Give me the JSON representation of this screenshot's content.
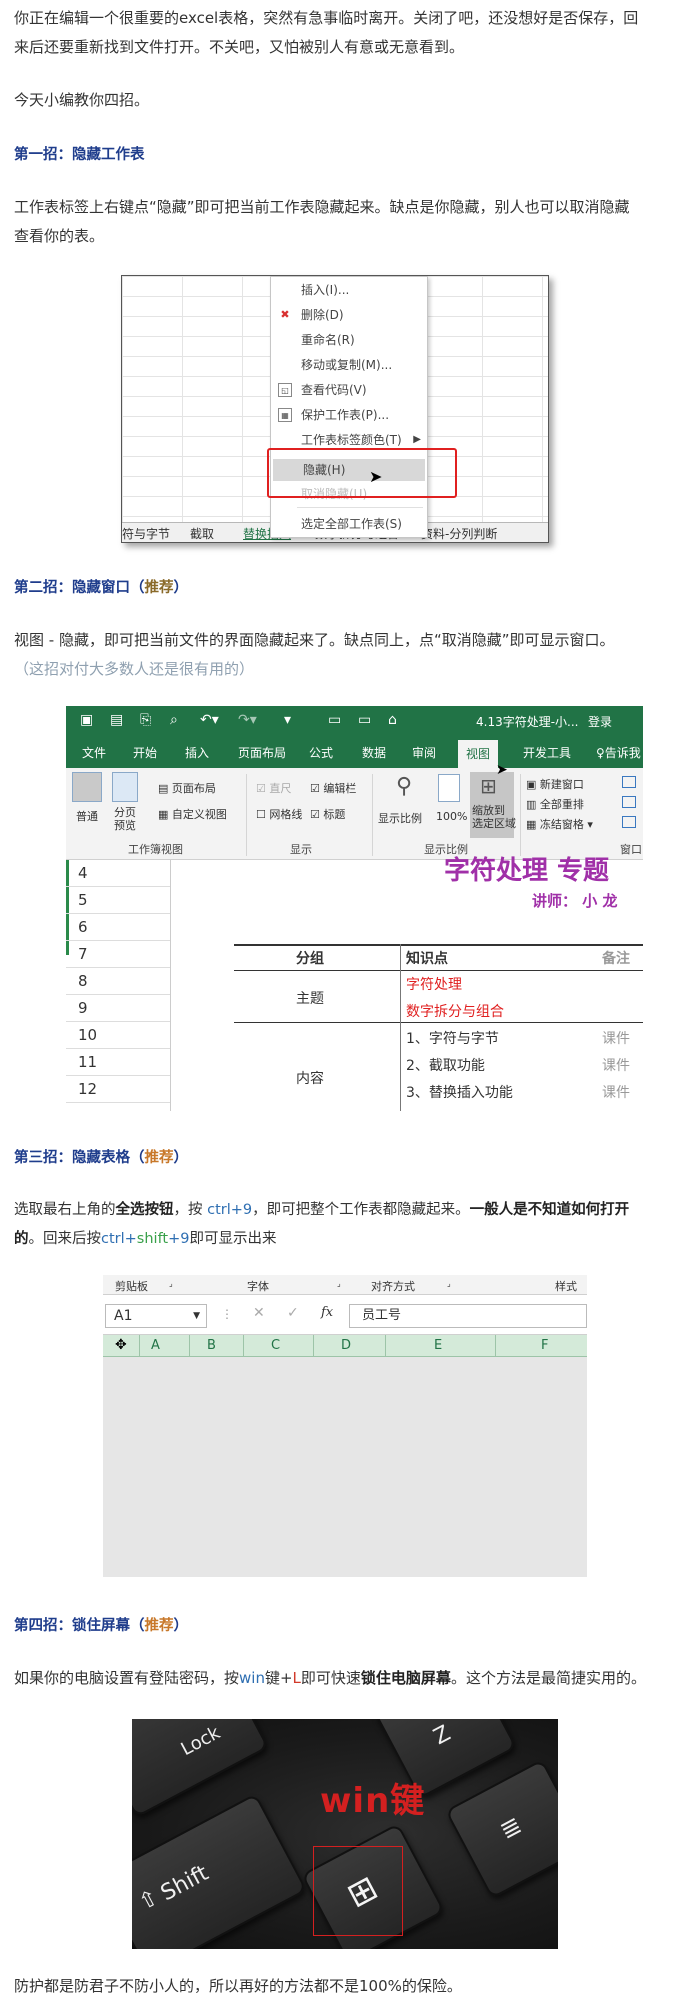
{
  "intro": {
    "line1": "你正在编辑一个很重要的excel表格，突然有急事临时离开。关闭了吧，还没想好是否保存，回",
    "line2": "来后还要重新找到文件打开。不关吧，又怕被别人有意或无意看到。",
    "teaser": "今天小编教你四招。"
  },
  "tip1": {
    "heading": "第一招：隐藏工作表",
    "line1": "工作表标签上右键点“隐藏”即可把当前工作表隐藏起来。缺点是你隐藏，别人也可以取消隐藏",
    "line2": "查看你的表。"
  },
  "context_menu": {
    "items": [
      {
        "label": "插入(I)...",
        "icon": "",
        "disabled": false
      },
      {
        "label": "删除(D)",
        "icon": "delete-sheet-icon",
        "disabled": false
      },
      {
        "label": "重命名(R)",
        "icon": "",
        "disabled": false
      },
      {
        "label": "移动或复制(M)...",
        "icon": "",
        "disabled": false
      },
      {
        "label": "查看代码(V)",
        "icon": "view-code-icon",
        "disabled": false
      },
      {
        "label": "保护工作表(P)...",
        "icon": "protect-sheet-icon",
        "disabled": false
      },
      {
        "label": "工作表标签颜色(T)",
        "icon": "",
        "disabled": false
      },
      {
        "label": "隐藏(H)",
        "icon": "",
        "disabled": false
      },
      {
        "label": "取消隐藏(U)...",
        "icon": "",
        "disabled": true
      },
      {
        "label": "选定全部工作表(S)",
        "icon": "",
        "disabled": false
      }
    ],
    "sheet_tabs": [
      "符与字节",
      "截取",
      "替换插入",
      "数字拆分与组合",
      "资料-分列判断"
    ]
  },
  "tip2": {
    "heading_main": "第二招：隐藏窗口",
    "heading_paren_open": "（",
    "heading_rec": "推荐",
    "heading_paren_close": "）",
    "line1": "视图 - 隐藏，即可把当前文件的界面隐藏起来了。缺点同上，点“取消隐藏”即可显示窗口。",
    "line2": "（这招对付大多数人还是很有用的）"
  },
  "excel_window": {
    "title": "4.13字符处理-小...",
    "login": "登录",
    "tabs": [
      "文件",
      "开始",
      "插入",
      "页面布局",
      "公式",
      "数据",
      "审阅",
      "视图",
      "开发工具",
      "告诉我"
    ],
    "active_tab": "视图",
    "ribbon": {
      "normal": "普通",
      "page_break": "分页\n预览",
      "page_layout": "页面布局",
      "custom_view": "自定义视图",
      "group_views": "工作簿视图",
      "ruler": "直尺",
      "formula_bar": "编辑栏",
      "gridlines": "网格线",
      "headings": "标题",
      "group_show": "显示",
      "zoom": "显示比例",
      "zoom100": "100%",
      "zoom_selection": "缩放到\n选定区域",
      "group_zoom": "显示比例",
      "new_window": "新建窗口",
      "arrange_all": "全部重排",
      "freeze": "冻结窗格",
      "group_window": "窗口"
    },
    "rows": [
      "4",
      "5",
      "6",
      "7",
      "8",
      "9",
      "10",
      "11",
      "12"
    ],
    "big_title": "字符处理  专题",
    "lecturer": "讲师：  小 龙",
    "table": {
      "headers": [
        "分组",
        "知识点",
        "备注"
      ],
      "group1": "主题",
      "topic1": "字符处理",
      "topic2": "数字拆分与组合",
      "group2": "内容",
      "items": [
        "1、字符与字节",
        "2、截取功能",
        "3、替换插入功能"
      ],
      "notes": [
        "课件",
        "课件",
        "课件"
      ]
    }
  },
  "tip3": {
    "heading_main": "第三招：隐藏表格",
    "heading_paren_open": "（",
    "heading_rec": "推荐",
    "heading_paren_close": "）",
    "l1_a": "选取最右上角的",
    "l1_b": "全选按钮",
    "l1_c": "，按 ",
    "l1_d": "ctrl+9",
    "l1_e": "，即可把整个工作表都隐藏起来。",
    "l1_f": "一般人是不知道如何打开",
    "l2_a": "的",
    "l2_b": "。回来后按",
    "l2_c": "ctrl+",
    "l2_d": "shift",
    "l2_e": "+9",
    "l2_f": "即可显示出来"
  },
  "hidden_sheet": {
    "groups": [
      "剪贴板",
      "字体",
      "对齐方式",
      "样式"
    ],
    "namebox": "A1",
    "fx": "fx",
    "formula": "员工号",
    "cols": [
      "A",
      "B",
      "C",
      "D",
      "E",
      "F"
    ]
  },
  "tip4": {
    "heading_main": "第四招：锁住屏幕",
    "heading_paren_open": "（",
    "heading_rec": "推荐",
    "heading_paren_close": "）",
    "l_a": "如果你的电脑设置有登陆密码，按",
    "l_b": "win",
    "l_c": "键+",
    "l_d": "L",
    "l_e": "即可快速",
    "l_f": "锁住电脑屏幕",
    "l_g": "。这个方法是最简捷实用的。"
  },
  "keyboard": {
    "win_label": "win键",
    "shift_label": "Shift",
    "lock_label": "Lock",
    "z_label": "Z"
  },
  "closing": "防护都是防君子不防小人的，所以再好的方法都不是100%的保险。"
}
